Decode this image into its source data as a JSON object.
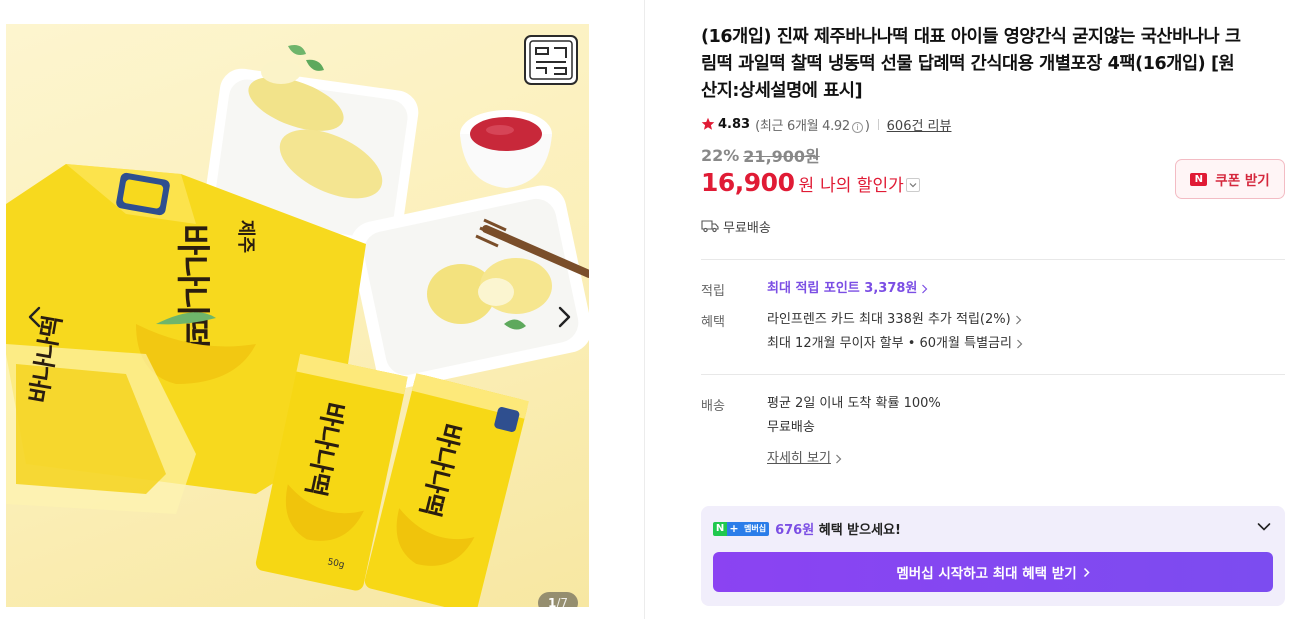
{
  "gallery": {
    "brand_mark": "돌담 은빛",
    "package_text": "바나나떡",
    "package_sub": "제주",
    "package_weight": "50g",
    "counter_current": "1",
    "counter_total": "/7"
  },
  "product": {
    "title": "(16개입) 진짜 제주바나나떡 대표 아이들 영양간식 굳지않는 국산바나나 크림떡 과일떡 찰떡 냉동떡 선물 답례떡 간식대용 개별포장 4팩(16개입) [원산지:상세설명에 표시]",
    "rating": "4.83",
    "rating_recent_prefix": "(최근 6개월 4.92",
    "rating_recent_suffix": ")",
    "info_symbol": "i",
    "review_link": "606건 리뷰",
    "discount_rate": "22%",
    "original_price": "21,900원",
    "sale_price": "16,900",
    "currency": "원",
    "my_price_label": "나의 할인가",
    "coupon_label": "쿠폰 받기",
    "coupon_badge": "N",
    "shipping_short": "무료배송"
  },
  "details": {
    "points_label": "적립",
    "points_text": "최대 적립 포인트 3,378원",
    "benefit_label": "혜택",
    "benefit_lines": [
      "라인프렌즈 카드 최대 338원 추가 적립(2%)",
      "최대 12개월 무이자 할부 • 60개월 특별금리"
    ],
    "delivery_label": "배송",
    "delivery_lines": [
      "평균 2일 이내 도착 확률 100%",
      "무료배송"
    ],
    "delivery_detail_link": "자세히 보기"
  },
  "membership": {
    "badge_n": "N",
    "badge_plus": "+",
    "badge_text": "멤버십",
    "amount": "676원",
    "suffix": " 혜택 받으세요!",
    "button_label": "멤버십 시작하고 최대 혜택 받기"
  },
  "colors": {
    "accent_red": "#e01b35",
    "accent_purple": "#7b4ee4",
    "member_bg": "#f1eefb"
  }
}
